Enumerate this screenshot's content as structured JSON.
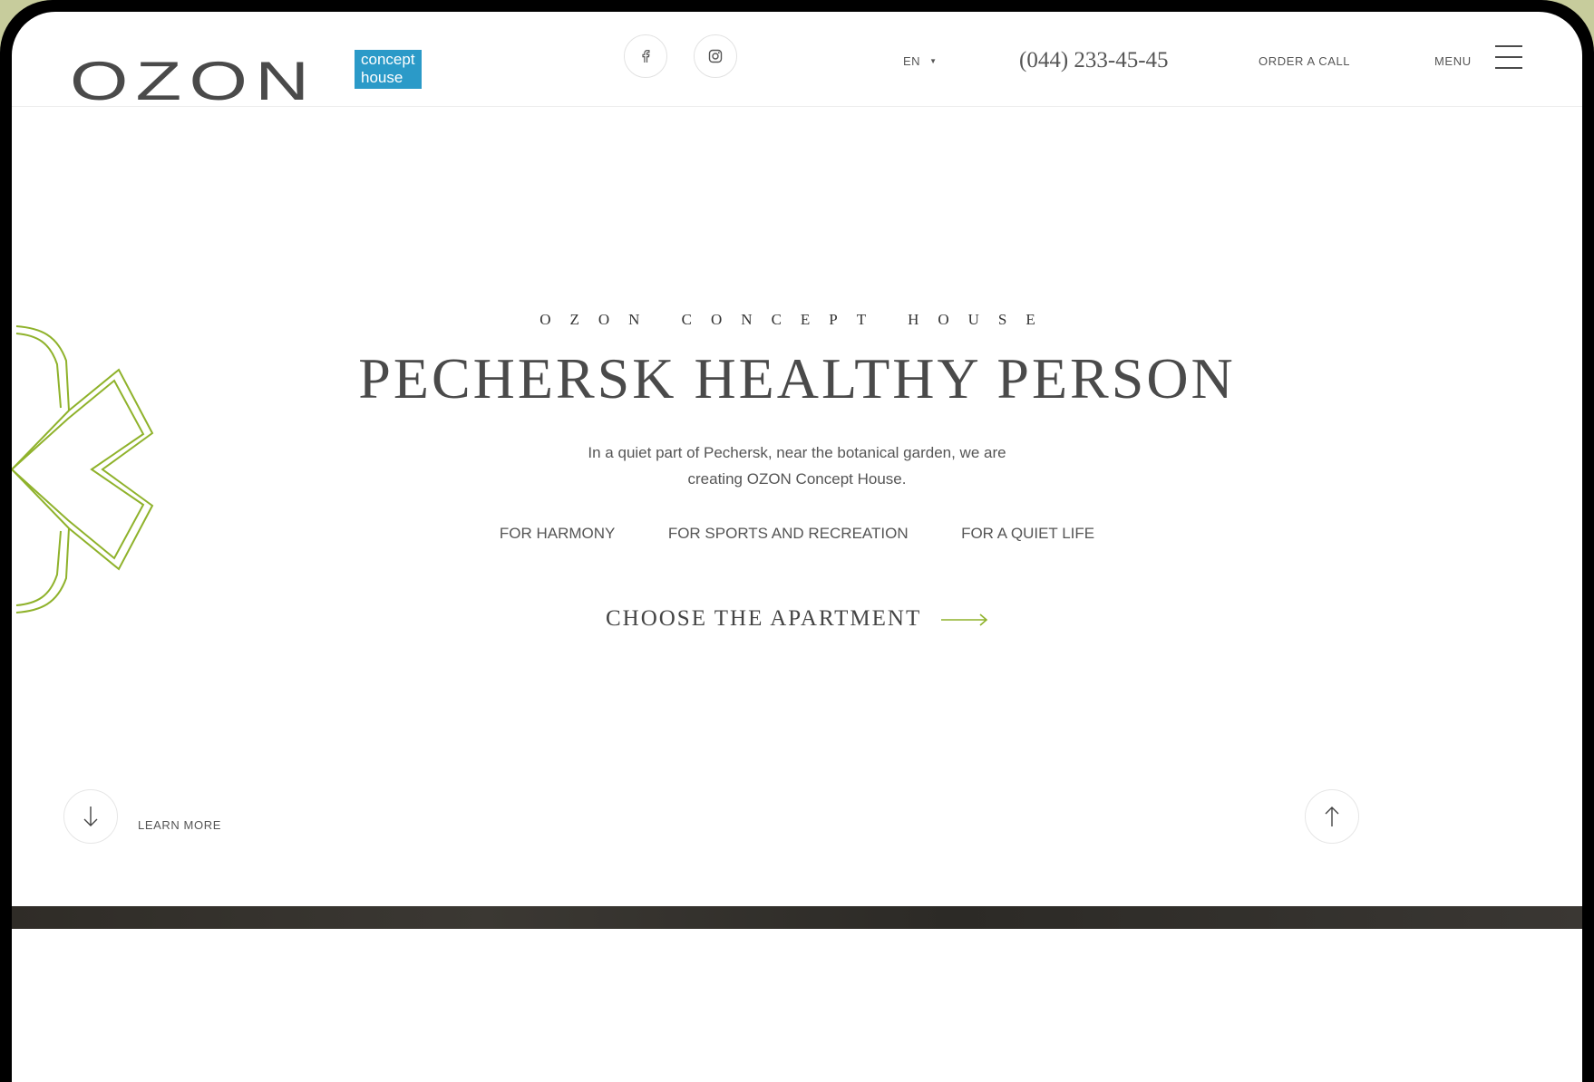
{
  "header": {
    "logo_word": "OZON",
    "logo_tag": "concept house",
    "social": [
      {
        "name": "facebook",
        "icon": "facebook-icon"
      },
      {
        "name": "instagram",
        "icon": "instagram-icon"
      }
    ],
    "language": "EN",
    "phone": "(044) 233-45-45",
    "order_call": "ORDER A CALL",
    "menu": "MENU"
  },
  "hero": {
    "eyebrow": "OZON CONCEPT HOUSE",
    "title": "PECHERSK HEALTHY PERSON",
    "description": "In a quiet part of Pechersk, near the botanical garden, we are creating OZON Concept House.",
    "features": [
      "FOR HARMONY",
      "FOR SPORTS AND RECREATION",
      "FOR A QUIET LIFE"
    ],
    "cta": "CHOOSE THE APARTMENT"
  },
  "footer_controls": {
    "learn_more": "LEARN MORE"
  },
  "colors": {
    "accent_green": "#8fb22b",
    "logo_blue": "#2b9ac8",
    "text": "#4a4a4a"
  }
}
